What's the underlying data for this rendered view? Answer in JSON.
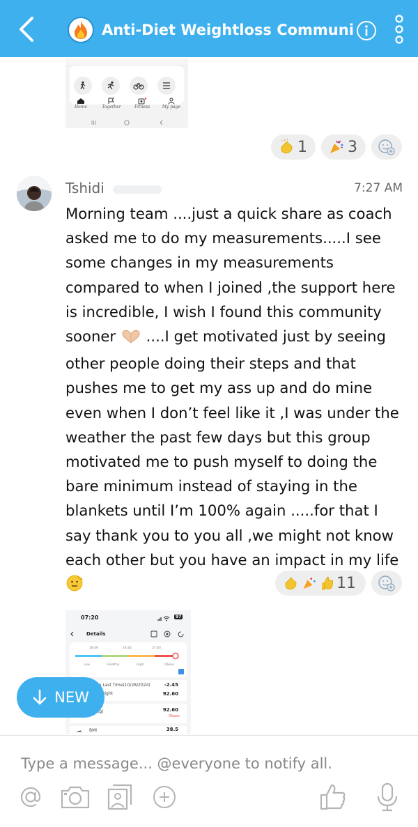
{
  "header": {
    "title": "Anti-Diet Weightloss Communi...",
    "group_icon": "fire-icon",
    "accent_color": "#3fb0ee"
  },
  "shot1": {
    "nav": [
      "Home",
      "Together",
      "Fitness",
      "My page"
    ]
  },
  "reactions_top": [
    {
      "emoji": "clap",
      "count": "1"
    },
    {
      "emoji": "party",
      "count": "3"
    }
  ],
  "message": {
    "sender": "Tshidi",
    "time": "7:27 AM",
    "text_before_heart": "Morning team ....just a quick share as coach asked me to do my measurements.....I see some changes in my measurements compared to when I joined ,the support here is incredible, I wish I found this community sooner ",
    "text_after_heart": " ....I get motivated just by seeing other people doing their steps and that pushes me to get my ass up and do mine even when I don’t feel like it ,I was under the weather the past few days but this group motivated me to push myself to doing the bare minimum instead of staying in the blankets until I’m 100% again .....for that I say thank you to you all ,we might not know each other but you have an impact in my life ",
    "reactions": {
      "emojis": [
        "clap",
        "party",
        "thumbs-up"
      ],
      "count": "11"
    }
  },
  "shot2": {
    "status_time": "07:20",
    "battery": "97",
    "title": "Details",
    "gauge_ticks": [
      "18.49",
      "24.82",
      "27.83"
    ],
    "gauge_labels": [
      "Low",
      "Healthy",
      "High",
      "Obese"
    ],
    "rows": [
      {
        "label": "...d to Last Time(10/28/2024)",
        "value": "-2.45"
      },
      {
        "label": "...st Weight",
        "value": "92.60"
      },
      {
        "label": "...t(Kg)",
        "value": "92.60",
        "sub": "Obese"
      },
      {
        "label": "BMI",
        "value": "38.5"
      }
    ]
  },
  "new_button": {
    "label": "NEW"
  },
  "composer": {
    "placeholder": "Type a message... @everyone to notify all."
  }
}
